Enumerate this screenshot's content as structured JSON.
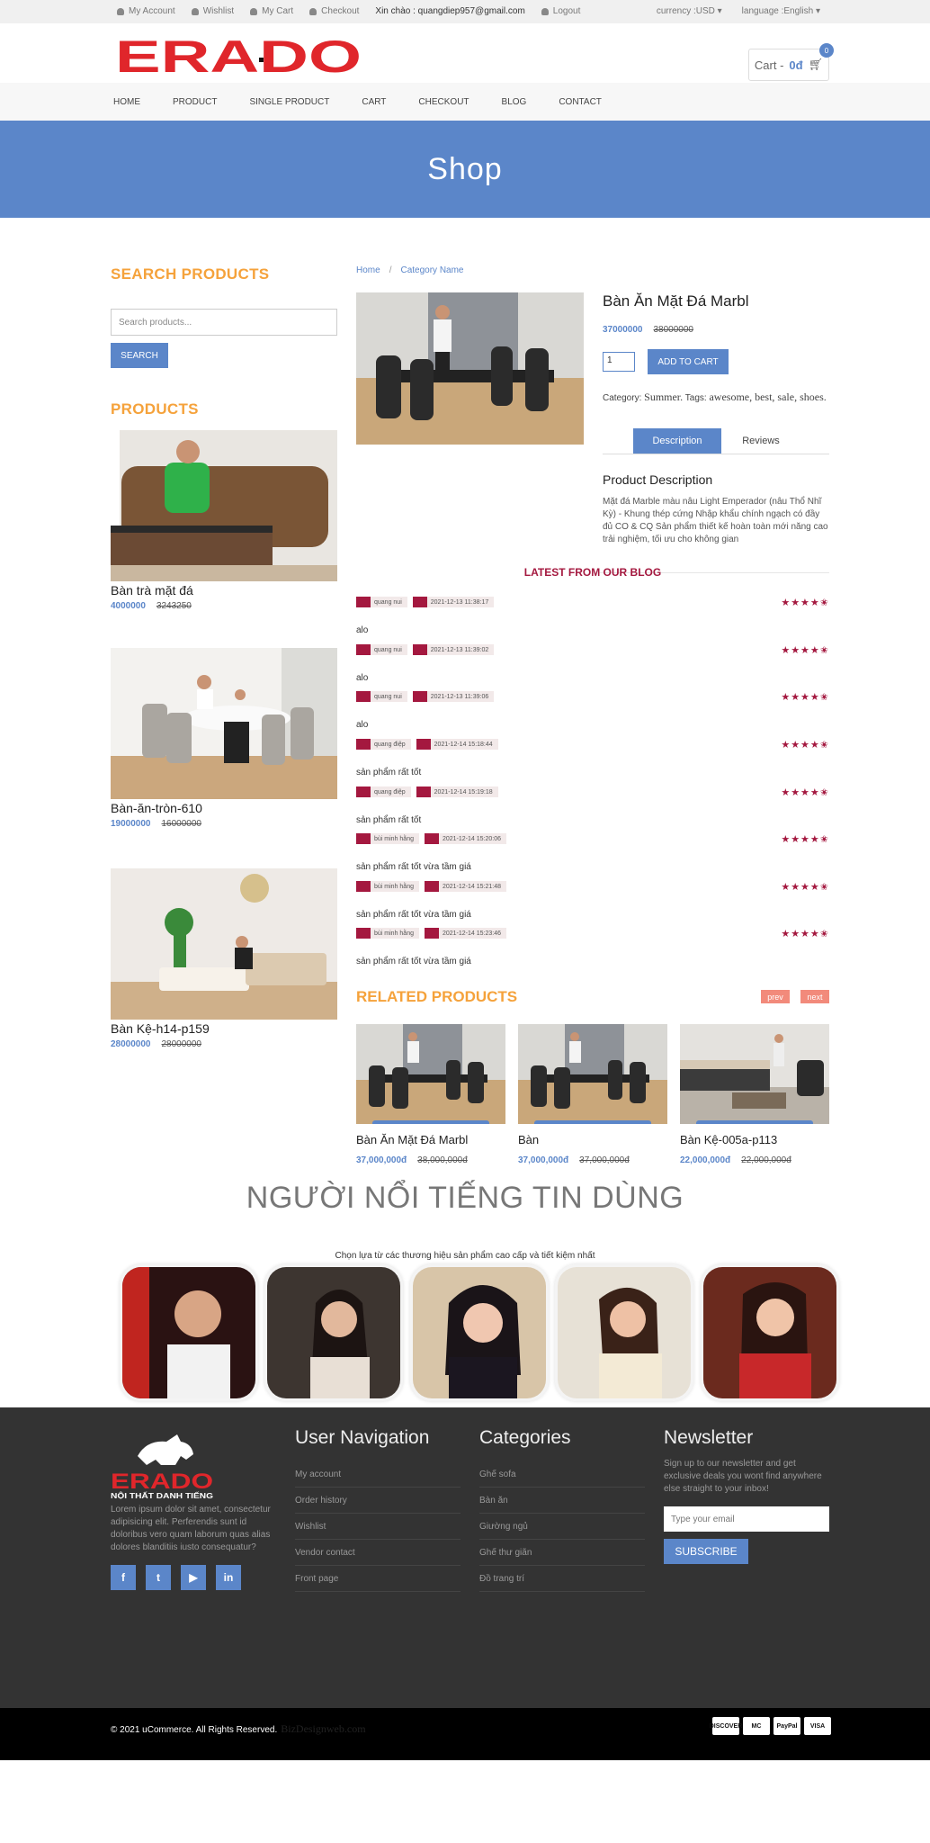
{
  "topbar": {
    "links": [
      "My Account",
      "Wishlist",
      "My Cart",
      "Checkout"
    ],
    "greeting": "Xin chào : quangdiep957@gmail.com",
    "logout": "Logout",
    "currency": "currency :USD",
    "language": "language :English"
  },
  "header": {
    "logo_text": "ERADO",
    "cart_label": "Cart -",
    "cart_amount": "0đ",
    "cart_count": "0"
  },
  "nav": [
    "HOME",
    "PRODUCT",
    "SINGLE PRODUCT",
    "CART",
    "CHECKOUT",
    "BLOG",
    "CONTACT"
  ],
  "hero": {
    "title": "Shop"
  },
  "sidebar": {
    "search_heading": "SEARCH PRODUCTS",
    "search_placeholder": "Search products...",
    "search_button": "SEARCH",
    "products_heading": "PRODUCTS",
    "products": [
      {
        "name": "Bàn trà mặt đá",
        "price": "4000000",
        "old_price": "3243250"
      },
      {
        "name": "Bàn-ăn-tròn-610",
        "price": "19000000",
        "old_price": "16000000"
      },
      {
        "name": "Bàn Kệ-h14-p159",
        "price": "28000000",
        "old_price": "28000000"
      }
    ]
  },
  "breadcrumb": {
    "home": "Home",
    "sep": "/",
    "category": "Category Name"
  },
  "product": {
    "title": "Bàn Ăn Mặt Đá Marbl",
    "price": "37000000",
    "old_price": "38000000",
    "qty": "1",
    "add_to_cart": "ADD TO CART",
    "category_prefix": "Category:",
    "category": "Summer.",
    "tags_prefix": "Tags:",
    "tags": "awesome, best, sale, shoes.",
    "tab_description": "Description",
    "tab_reviews": "Reviews",
    "desc_heading": "Product Description",
    "desc_text": "Mặt đá Marble màu nâu Light Emperador (nâu Thổ Nhĩ Kỳ) - Khung thép cứng Nhập khẩu chính ngạch có đầy đủ CO & CQ Sản phẩm thiết kế hoàn toàn mới năng cao trải nghiệm, tối ưu cho không gian"
  },
  "blog": {
    "heading": "LATEST FROM OUR BLOG",
    "stars": "★★★★✬",
    "comments": [
      {
        "author": "quang nui",
        "date": "2021-12-13 11:38:17",
        "text": "alo"
      },
      {
        "author": "quang nui",
        "date": "2021-12-13 11:39:02",
        "text": "alo"
      },
      {
        "author": "quang nui",
        "date": "2021-12-13 11:39:06",
        "text": "alo"
      },
      {
        "author": "quang điệp",
        "date": "2021-12-14 15:18:44",
        "text": "sản phẩm rất tốt"
      },
      {
        "author": "quang điệp",
        "date": "2021-12-14 15:19:18",
        "text": "sản phẩm rất tốt"
      },
      {
        "author": "bùi minh hằng",
        "date": "2021-12-14 15:20:06",
        "text": "sản phẩm rất tốt vừa tầm giá"
      },
      {
        "author": "bùi minh hằng",
        "date": "2021-12-14 15:21:48",
        "text": "sản phẩm rất tốt vừa tầm giá"
      },
      {
        "author": "bùi minh hằng",
        "date": "2021-12-14 15:23:46",
        "text": "sản phẩm rất tốt vừa tầm giá"
      }
    ]
  },
  "related": {
    "heading": "RELATED PRODUCTS",
    "prev": "prev",
    "next": "next",
    "items": [
      {
        "name": "Bàn Ăn Mặt Đá Marbl",
        "price": "37,000,000đ",
        "old_price": "38,000,000đ"
      },
      {
        "name": "Bàn",
        "price": "37,000,000đ",
        "old_price": "37,000,000đ"
      },
      {
        "name": "Bàn Kệ-005a-p113",
        "price": "22,000,000đ",
        "old_price": "22,000,000đ"
      }
    ]
  },
  "celebrities": {
    "title": "NGƯỜI NỔI TIẾNG TIN DÙNG",
    "subtitle": "Chọn lựa từ các thương hiệu sản phẩm cao cấp và tiết kiệm nhất"
  },
  "footer": {
    "logo_text": "ERADO",
    "logo_sub": "NỘI THẤT DANH TIẾNG",
    "about": "Lorem ipsum dolor sit amet, consectetur adipisicing elit. Perferendis sunt id doloribus vero quam laborum quas alias dolores blanditiis iusto consequatur?",
    "social": [
      "f",
      "t",
      "▶",
      "in"
    ],
    "nav_heading": "User Navigation",
    "nav_items": [
      "My account",
      "Order history",
      "Wishlist",
      "Vendor contact",
      "Front page"
    ],
    "cat_heading": "Categories",
    "cat_items": [
      "Ghế sofa",
      "Bàn ăn",
      "Giường ngủ",
      "Ghế thư giãn",
      "Đồ trang trí"
    ],
    "nl_heading": "Newsletter",
    "nl_text": "Sign up to our newsletter and get exclusive deals you wont find anywhere else straight to your inbox!",
    "nl_placeholder": "Type your email",
    "nl_button": "SUBSCRIBE"
  },
  "bottom": {
    "copyright": "© 2021 uCommerce. All Rights Reserved.",
    "watermark": "BizDesignweb.com",
    "payments": [
      "DISCOVER",
      "MC",
      "PayPal",
      "VISA"
    ]
  },
  "colors": {
    "accent": "#5b86c9",
    "orange": "#f5a23b",
    "crimson": "#a4183f",
    "logo_red": "#e0262b"
  }
}
